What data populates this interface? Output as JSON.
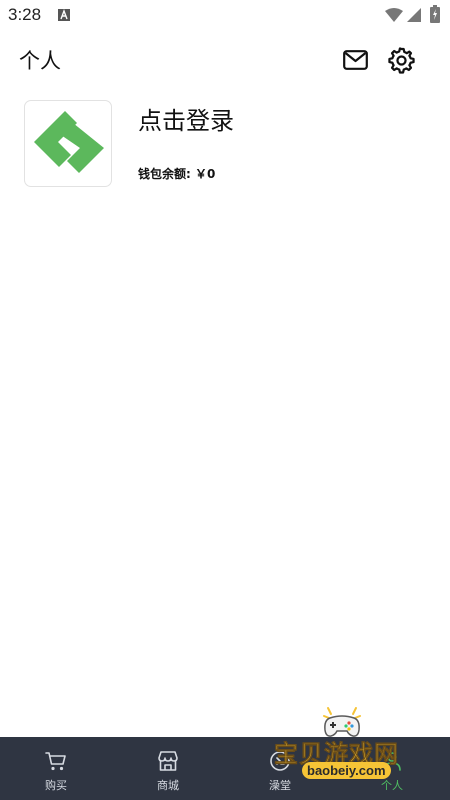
{
  "status_bar": {
    "time": "3:28",
    "icons": [
      "a-icon",
      "wifi-icon",
      "signal-icon",
      "battery-icon"
    ]
  },
  "header": {
    "title": "个人",
    "icons": [
      "mail-icon",
      "gear-icon"
    ]
  },
  "profile": {
    "login_label": "点击登录",
    "wallet_label": "钱包余额:",
    "wallet_value": "￥0",
    "logo_icon": "app-logo-icon"
  },
  "bottom_nav": {
    "items": [
      {
        "label": "购买",
        "icon": "cart-icon",
        "active": false
      },
      {
        "label": "商城",
        "icon": "store-icon",
        "active": false
      },
      {
        "label": "澡堂",
        "icon": "bath-icon",
        "active": false
      },
      {
        "label": "个人",
        "icon": "person-icon",
        "active": true
      }
    ]
  },
  "watermark": {
    "text": "宝贝游戏网",
    "url": "baobeiy.com"
  },
  "colors": {
    "nav_bg": "#2f3542",
    "active": "#4fbf62",
    "logo_green": "#5cb85c",
    "watermark_yellow": "#f6c436"
  }
}
